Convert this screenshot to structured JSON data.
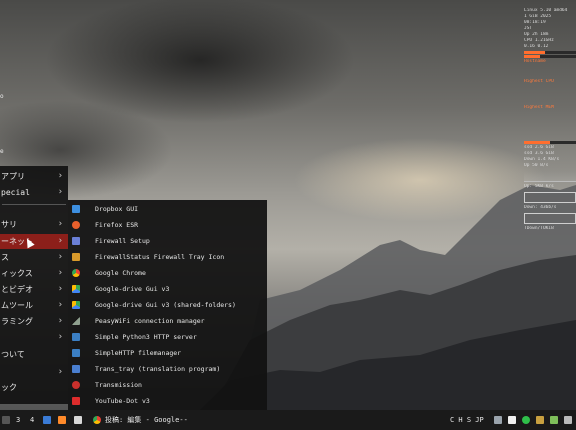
{
  "desktop": {
    "left_glimpses": [
      "o",
      "e"
    ]
  },
  "main_menu": {
    "items": [
      {
        "label": "アプリ",
        "has_submenu": true
      },
      {
        "label": "pecial",
        "has_submenu": true
      },
      {
        "label": "サリ",
        "has_submenu": true
      },
      {
        "label": "ーネット",
        "has_submenu": true,
        "active": true
      },
      {
        "label": "ス",
        "has_submenu": true
      },
      {
        "label": "ィックス",
        "has_submenu": true
      },
      {
        "label": "とビデオ",
        "has_submenu": true
      },
      {
        "label": "ムツール",
        "has_submenu": true
      },
      {
        "label": "ラミング",
        "has_submenu": true
      },
      {
        "label": "",
        "has_submenu": true
      },
      {
        "label": "ついて",
        "has_submenu": false
      },
      {
        "label": "",
        "has_submenu": true
      },
      {
        "label": "ック",
        "has_submenu": false
      }
    ]
  },
  "internet_submenu": {
    "items": [
      {
        "label": "Dropbox GUI",
        "icon": "dropbox-icon",
        "color": "#3d8fe0"
      },
      {
        "label": "Firefox ESR",
        "icon": "firefox-icon",
        "color": "#e8602c"
      },
      {
        "label": "Firewall Setup",
        "icon": "firewall-icon",
        "color": "#6a7fd6"
      },
      {
        "label": "FirewallStatus Firewall Tray Icon",
        "icon": "firewall-status-icon",
        "color": "#d99a2b"
      },
      {
        "label": "Google Chrome",
        "icon": "chrome-icon",
        "color": "#e94235"
      },
      {
        "label": "Google-drive Gui v3",
        "icon": "google-drive-icon",
        "color": "#34a853"
      },
      {
        "label": "Google-drive Gui v3 (shared-folders)",
        "icon": "google-drive-shared-icon",
        "color": "#34a853"
      },
      {
        "label": "PeasyWiFi connection manager",
        "icon": "wifi-icon",
        "color": "#7a8a7a"
      },
      {
        "label": "Simple Python3 HTTP server",
        "icon": "python-server-icon",
        "color": "#3b7fc4"
      },
      {
        "label": "SimpleHTTP filemanager",
        "icon": "filemanager-icon",
        "color": "#3b7fc4"
      },
      {
        "label": "Trans_tray (translation program)",
        "icon": "translate-icon",
        "color": "#4a7fd0"
      },
      {
        "label": "Transmission",
        "icon": "transmission-icon",
        "color": "#c9302c"
      },
      {
        "label": "YouTube-Dot v3",
        "icon": "youtube-icon",
        "color": "#dd2c2c"
      }
    ]
  },
  "taskbar": {
    "workspaces": [
      "3",
      "4"
    ],
    "window_title": "投稿: 編集 - Google--",
    "tray_text": "C H S JP"
  },
  "conky": {
    "lines": [
      "Linux 5.10 amd64",
      "1 GiB 2025",
      "08:18:19",
      "JST",
      "Up 2h 18m",
      "CPU 1.21GHz",
      "0.16 0.12",
      "Hostname",
      "Highest CPU",
      "Highest MEM",
      "ssd 2.6 GiB",
      "ssd 3.6 GiB",
      "Down 1.4 KB/s",
      "Up 50 B/s",
      "Up: 5KB k/s",
      "Down: 436b/s",
      "TDown/TUKiB"
    ],
    "accent": "#ff6e2e",
    "cpu_fraction": 0.4,
    "mem_fraction": 0.3
  }
}
